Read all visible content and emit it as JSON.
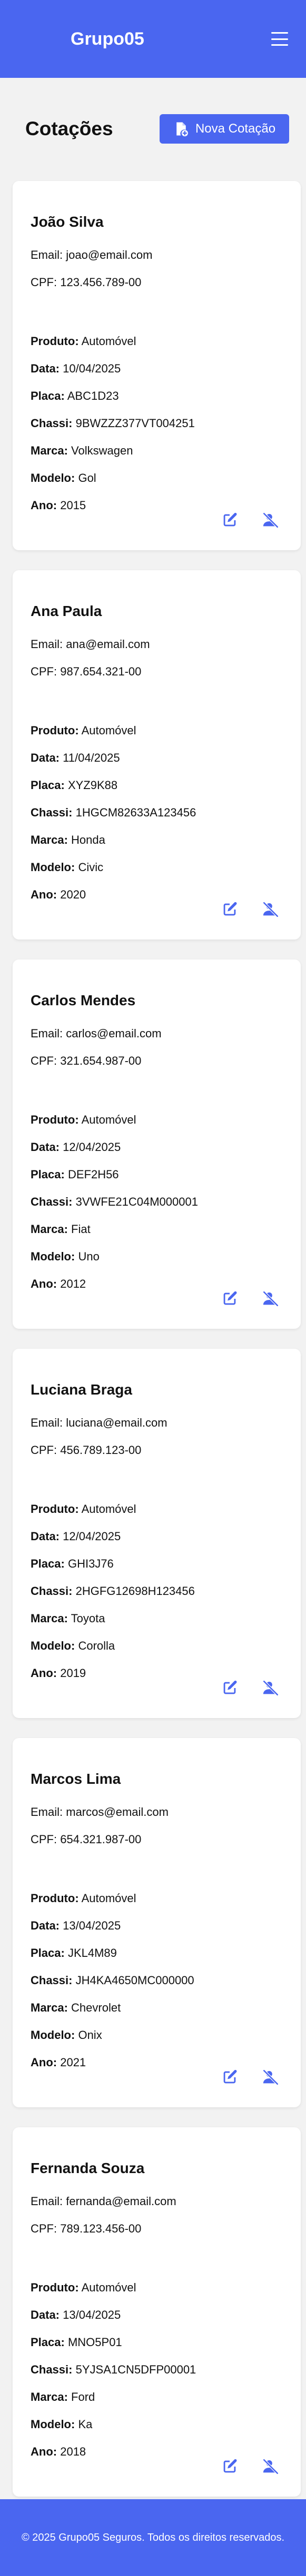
{
  "header": {
    "brand": "Grupo05",
    "menu_icon": "hamburger-menu-icon"
  },
  "page": {
    "title": "Cotações",
    "new_button_label": "Nova Cotação",
    "new_button_icon": "file-add-icon"
  },
  "labels": {
    "email": "Email:",
    "cpf": "CPF:",
    "produto": "Produto:",
    "data": "Data:",
    "placa": "Placa:",
    "chassi": "Chassi:",
    "marca": "Marca:",
    "modelo": "Modelo:",
    "ano": "Ano:"
  },
  "icons": {
    "edit": "edit-icon",
    "remove": "user-remove-icon"
  },
  "colors": {
    "primary": "#4a66f0"
  },
  "quotes": [
    {
      "name": "João Silva",
      "email": "joao@email.com",
      "cpf": "123.456.789-00",
      "produto": "Automóvel",
      "data": "10/04/2025",
      "placa": "ABC1D23",
      "chassi": "9BWZZZ377VT004251",
      "marca": "Volkswagen",
      "modelo": "Gol",
      "ano": "2015"
    },
    {
      "name": "Ana Paula",
      "email": "ana@email.com",
      "cpf": "987.654.321-00",
      "produto": "Automóvel",
      "data": "11/04/2025",
      "placa": "XYZ9K88",
      "chassi": "1HGCM82633A123456",
      "marca": "Honda",
      "modelo": "Civic",
      "ano": "2020"
    },
    {
      "name": "Carlos Mendes",
      "email": "carlos@email.com",
      "cpf": "321.654.987-00",
      "produto": "Automóvel",
      "data": "12/04/2025",
      "placa": "DEF2H56",
      "chassi": "3VWFE21C04M000001",
      "marca": "Fiat",
      "modelo": "Uno",
      "ano": "2012"
    },
    {
      "name": "Luciana Braga",
      "email": "luciana@email.com",
      "cpf": "456.789.123-00",
      "produto": "Automóvel",
      "data": "12/04/2025",
      "placa": "GHI3J76",
      "chassi": "2HGFG12698H123456",
      "marca": "Toyota",
      "modelo": "Corolla",
      "ano": "2019"
    },
    {
      "name": "Marcos Lima",
      "email": "marcos@email.com",
      "cpf": "654.321.987-00",
      "produto": "Automóvel",
      "data": "13/04/2025",
      "placa": "JKL4M89",
      "chassi": "JH4KA4650MC000000",
      "marca": "Chevrolet",
      "modelo": "Onix",
      "ano": "2021"
    },
    {
      "name": "Fernanda Souza",
      "email": "fernanda@email.com",
      "cpf": "789.123.456-00",
      "produto": "Automóvel",
      "data": "13/04/2025",
      "placa": "MNO5P01",
      "chassi": "5YJSA1CN5DFP00001",
      "marca": "Ford",
      "modelo": "Ka",
      "ano": "2018"
    }
  ],
  "footer": {
    "text": "© 2025 Grupo05 Seguros. Todos os direitos reservados."
  }
}
